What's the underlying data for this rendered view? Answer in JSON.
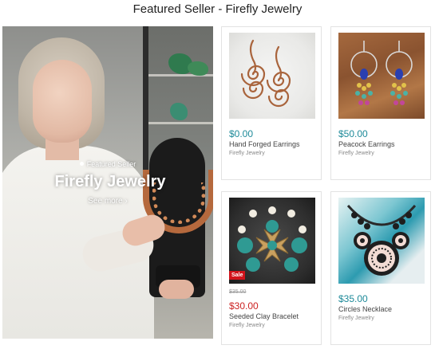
{
  "page": {
    "title": "Featured Seller - Firefly Jewelry"
  },
  "hero": {
    "eyebrow": "Featured Seller",
    "title": "Firefly Jewelry",
    "link_label": "See more ›"
  },
  "products": [
    {
      "price": "$0.00",
      "name": "Hand Forged Earrings",
      "seller": "Firefly Jewelry",
      "on_sale": false
    },
    {
      "price": "$50.00",
      "name": "Peacock Earrings",
      "seller": "Firefly Jewelry",
      "on_sale": false
    },
    {
      "price": "$30.00",
      "old_price": "$35.00",
      "name": "Seeded Clay Bracelet",
      "seller": "Firefly Jewelry",
      "on_sale": true,
      "badge": "Sale"
    },
    {
      "price": "$35.00",
      "name": "Circles Necklace",
      "seller": "Firefly Jewelry",
      "on_sale": false
    }
  ],
  "colors": {
    "price": "#1e8a99",
    "sale_price": "#cc2222",
    "sale_badge": "#d1131b"
  }
}
